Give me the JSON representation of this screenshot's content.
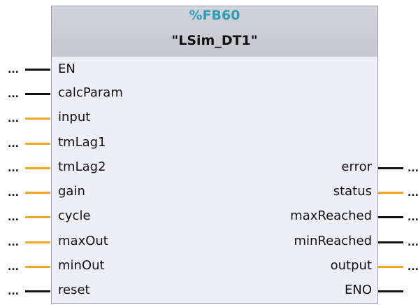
{
  "block": {
    "number": "%FB60",
    "name": "\"LSim_DT1\""
  },
  "connection_placeholder": "...",
  "colors": {
    "bool_wire": "#111111",
    "value_wire": "#f5a623",
    "fb_number": "#2e9fb0"
  },
  "inputs": [
    {
      "label": "EN",
      "wire": "black"
    },
    {
      "label": "calcParam",
      "wire": "black"
    },
    {
      "label": "input",
      "wire": "orange"
    },
    {
      "label": "tmLag1",
      "wire": "orange"
    },
    {
      "label": "tmLag2",
      "wire": "orange"
    },
    {
      "label": "gain",
      "wire": "orange"
    },
    {
      "label": "cycle",
      "wire": "orange"
    },
    {
      "label": "maxOut",
      "wire": "orange"
    },
    {
      "label": "minOut",
      "wire": "orange"
    },
    {
      "label": "reset",
      "wire": "black"
    }
  ],
  "outputs": [
    {
      "label": "error",
      "wire": "black"
    },
    {
      "label": "status",
      "wire": "orange"
    },
    {
      "label": "maxReached",
      "wire": "black"
    },
    {
      "label": "minReached",
      "wire": "black"
    },
    {
      "label": "output",
      "wire": "orange"
    },
    {
      "label": "ENO",
      "wire": "black"
    }
  ]
}
